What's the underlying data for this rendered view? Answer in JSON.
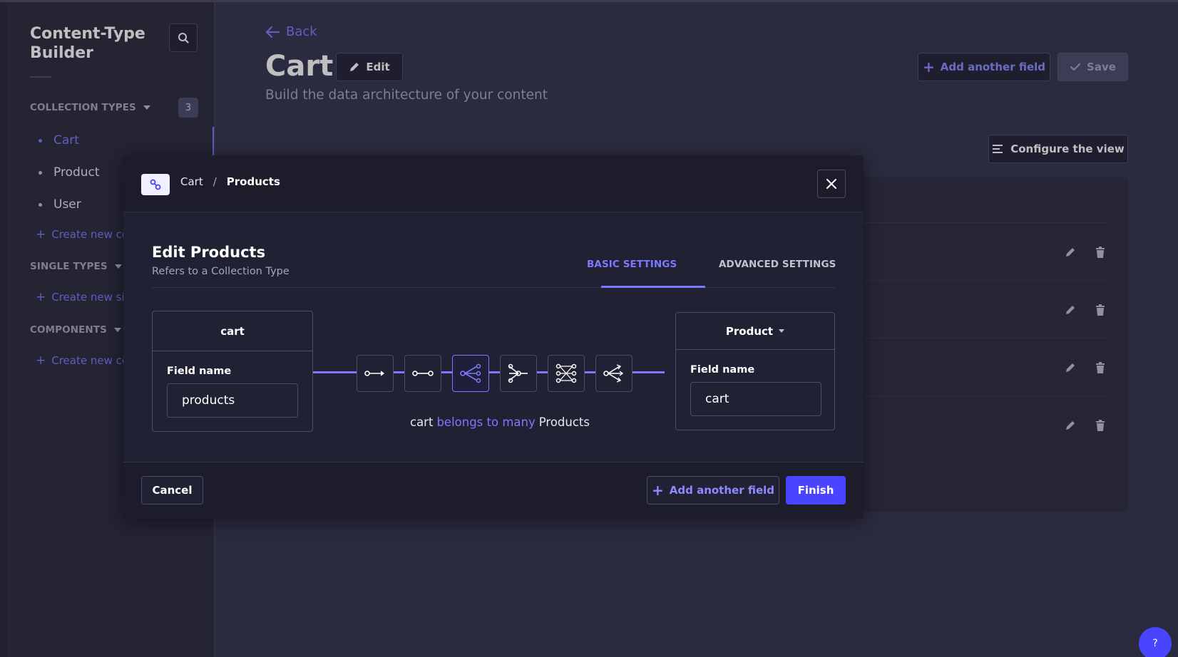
{
  "sidebar": {
    "title": "Content-Type Builder",
    "collection_types": {
      "label": "COLLECTION TYPES",
      "count": "3",
      "items": [
        {
          "label": "Cart",
          "active": true
        },
        {
          "label": "Product",
          "active": false
        },
        {
          "label": "User",
          "active": false
        }
      ],
      "create_label": "Create new collection type"
    },
    "single_types": {
      "label": "SINGLE TYPES",
      "create_label": "Create new single type"
    },
    "components": {
      "label": "COMPONENTS",
      "create_label": "Create new component"
    }
  },
  "header": {
    "back_label": "Back",
    "title": "Cart",
    "edit_label": "Edit",
    "subtitle": "Build the data architecture of your content",
    "add_field_label": "Add another field",
    "save_label": "Save",
    "configure_label": "Configure the view"
  },
  "modal": {
    "breadcrumb": [
      "Cart",
      "Products"
    ],
    "breadcrumb_separator": "/",
    "title": "Edit Products",
    "subtitle": "Refers to a Collection Type",
    "tabs": [
      {
        "label": "BASIC SETTINGS",
        "active": true
      },
      {
        "label": "ADVANCED SETTINGS",
        "active": false
      }
    ],
    "left": {
      "name": "cart",
      "field_label": "Field name",
      "field_value": "products"
    },
    "right": {
      "target": "Product",
      "field_label": "Field name",
      "field_value": "cart"
    },
    "relations": [
      {
        "icon": "one-to-one-icon",
        "selected": false
      },
      {
        "icon": "one-to-many-icon",
        "selected": false
      },
      {
        "icon": "many-to-one-icon",
        "selected": true
      },
      {
        "icon": "one-way-many-icon",
        "selected": false
      },
      {
        "icon": "many-to-many-icon",
        "selected": false
      },
      {
        "icon": "many-way-icon",
        "selected": false
      }
    ],
    "relation_text": {
      "subject": "cart",
      "verb": "belongs to many",
      "object": "Products"
    },
    "cancel_label": "Cancel",
    "add_field_label": "Add another field",
    "finish_label": "Finish"
  },
  "help_label": "?",
  "colors": {
    "accent": "#7b79ff",
    "primary_button": "#4945ff",
    "background": "#32324a",
    "surface": "#212134"
  }
}
